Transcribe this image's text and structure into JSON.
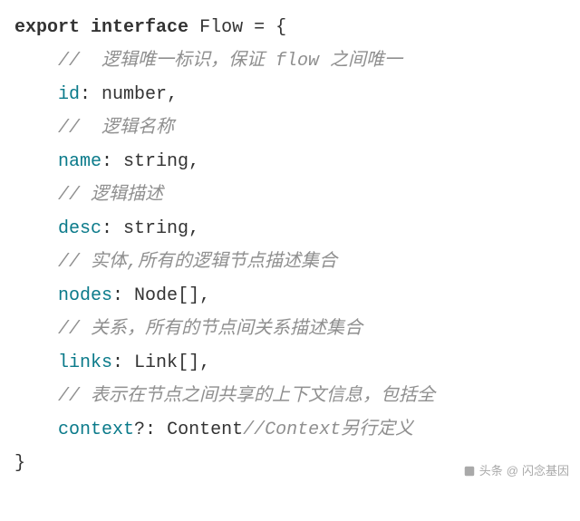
{
  "code": {
    "kw_export": "export",
    "kw_interface": "interface",
    "iface_name": "Flow",
    "eq": " = ",
    "lbrace": "{",
    "rbrace": "}",
    "indent": "    ",
    "colon_sp": ": ",
    "comma": ",",
    "opt": "?",
    "arr": "[]",
    "cmt_pfx": "// ",
    "cmt_pfx2": "//  ",
    "cmt_id": "逻辑唯一标识，保证 flow 之间唯一",
    "prop_id": "id",
    "type_id": "number",
    "cmt_name": "逻辑名称",
    "prop_name": "name",
    "type_name": "string",
    "cmt_desc": "逻辑描述",
    "prop_desc": "desc",
    "type_desc": "string",
    "cmt_nodes": "实体,所有的逻辑节点描述集合",
    "prop_nodes": "nodes",
    "type_nodes": "Node",
    "cmt_links": "关系，所有的节点间关系描述集合",
    "prop_links": "links",
    "type_links": "Link",
    "cmt_context": "表示在节点之间共享的上下文信息，包括全",
    "prop_context": "context",
    "type_context": "Content",
    "cmt_context_tail": "//Context另行定义"
  },
  "watermark": {
    "prefix": "头条",
    "at": "@",
    "author": "闪念基因"
  }
}
